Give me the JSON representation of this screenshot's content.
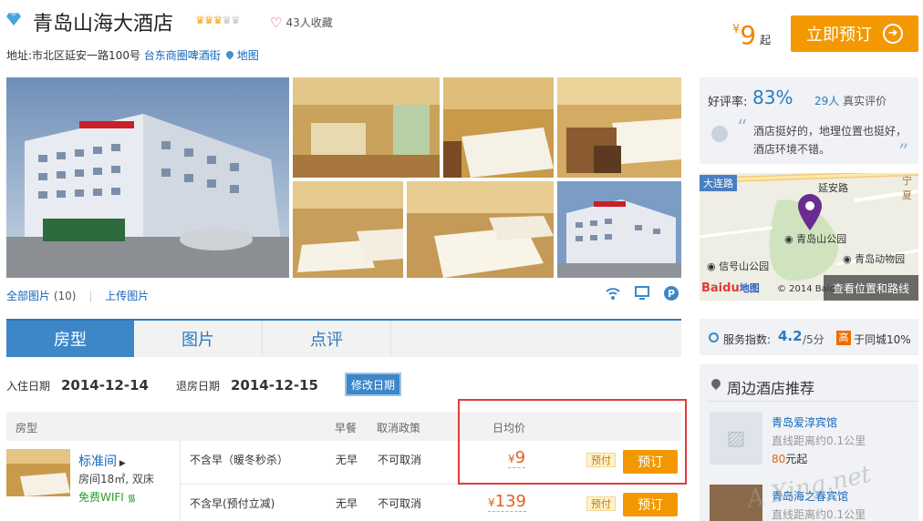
{
  "hotel": {
    "name": "青岛山海大酒店",
    "favorites": "43人收藏",
    "address_label": "地址:",
    "address": "市北区延安一路100号",
    "district_link": "台东商圈啤酒街",
    "map_link": "地图"
  },
  "header_price": {
    "currency": "¥",
    "value": "9",
    "suffix": "起"
  },
  "book_now": "立即预订",
  "photos": {
    "all_label": "全部图片",
    "count": "(10)",
    "upload": "上传图片"
  },
  "rating": {
    "label": "好评率:",
    "value": "83%",
    "reviews_num": "29",
    "reviews_unit": "人",
    "reviews_text": "真实评价",
    "quote": "酒店挺好的，地理位置也挺好，酒店环境不错。"
  },
  "map": {
    "roads": [
      "大连路",
      "延安路",
      "宁夏"
    ],
    "pois": [
      "青岛山公园",
      "信号山公园",
      "青岛动物园"
    ],
    "baidu_logo": "Baidu",
    "baidu_map": "地图",
    "copyright": "© 2014 Baidu",
    "view_route": "查看位置和路线"
  },
  "service": {
    "label": "服务指数:",
    "value": "4.2",
    "max": "/5分",
    "badge": "高",
    "compare": "于同城10%"
  },
  "tabs": [
    "房型",
    "图片",
    "点评"
  ],
  "dates": {
    "checkin_label": "入住日期",
    "checkin": "2014-12-14",
    "checkout_label": "退房日期",
    "checkout": "2014-12-15",
    "modify": "修改日期"
  },
  "table": {
    "headers": [
      "房型",
      "早餐",
      "取消政策",
      "日均价"
    ],
    "room": {
      "name": "标准间",
      "info": "房间18㎡, 双床",
      "wifi": "免费WIFI"
    },
    "rows": [
      {
        "plan": "不含早（暖冬秒杀）",
        "breakfast": "无早",
        "cancel": "不可取消",
        "currency": "¥",
        "price": "9",
        "prepay": "预付",
        "book": "预订"
      },
      {
        "plan": "不含早(预付立减)",
        "breakfast": "无早",
        "cancel": "不可取消",
        "currency": "¥",
        "price": "139",
        "prepay": "预付",
        "book": "预订"
      }
    ]
  },
  "nearby": {
    "title": "周边酒店推荐",
    "items": [
      {
        "name": "青岛爱淳宾馆",
        "dist": "直线距离约0.1公里",
        "price": "80",
        "unit": "元起"
      },
      {
        "name": "青岛海之春宾馆",
        "dist": "直线距离约0.1公里"
      }
    ]
  },
  "watermark": "A Xing.net",
  "colors": {
    "accent": "#2a7ac0",
    "orange": "#f39800",
    "price": "#e0621b",
    "highlight_box": "#e03b3b"
  }
}
